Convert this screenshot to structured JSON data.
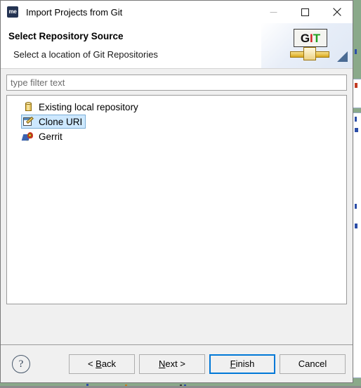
{
  "window": {
    "title": "Import Projects from Git",
    "app_icon": "me",
    "app_icon_name": "mendix-app-icon",
    "controls": {
      "minimize": "minimize-icon",
      "maximize": "maximize-icon",
      "close": "close-icon"
    }
  },
  "header": {
    "title": "Select Repository Source",
    "subtitle": "Select a location of Git Repositories",
    "logo": {
      "g": "G",
      "i": "I",
      "t": "T",
      "g_color": "#111111",
      "i_color": "#d02020",
      "t_color": "#1f9e1f"
    }
  },
  "filter": {
    "value": "",
    "placeholder": "type filter text"
  },
  "tree": {
    "items": [
      {
        "label": "Existing local repository",
        "icon": "database-icon",
        "selected": false
      },
      {
        "label": "Clone URI",
        "icon": "clone-uri-icon",
        "selected": true
      },
      {
        "label": "Gerrit",
        "icon": "gerrit-icon",
        "selected": false
      }
    ]
  },
  "footer": {
    "help_label": "?",
    "buttons": [
      {
        "label": "< Back",
        "mnemonic": "B",
        "default": false
      },
      {
        "label": "Next >",
        "mnemonic": "N",
        "default": false
      },
      {
        "label": "Finish",
        "mnemonic": "F",
        "default": true
      },
      {
        "label": "Cancel",
        "mnemonic": "",
        "default": false
      }
    ]
  },
  "colors": {
    "accent": "#0078d7",
    "selection_fill": "#cde8ff",
    "selection_border": "#7aaed6",
    "dialog_bg": "#f0f0f0"
  }
}
